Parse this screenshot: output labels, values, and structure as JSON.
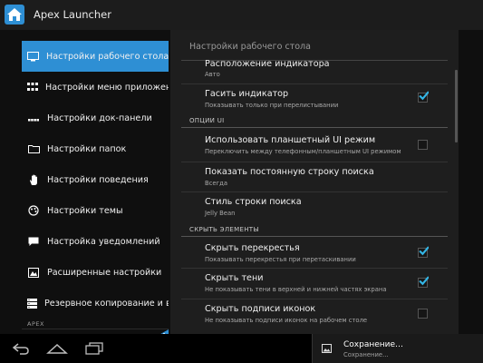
{
  "app": {
    "title": "Apex Launcher"
  },
  "sidebar": {
    "items": [
      {
        "label": "Настройки рабочего стола",
        "icon": "monitor-icon",
        "active": true
      },
      {
        "label": "Настройки меню приложений",
        "icon": "app-grid-icon",
        "active": false
      },
      {
        "label": "Настройки док-панели",
        "icon": "dock-icon",
        "active": false
      },
      {
        "label": "Настройки папок",
        "icon": "folder-icon",
        "active": false
      },
      {
        "label": "Настройки поведения",
        "icon": "hand-icon",
        "active": false
      },
      {
        "label": "Настройки темы",
        "icon": "palette-icon",
        "active": false
      },
      {
        "label": "Настройка уведомлений",
        "icon": "speech-bubble-icon",
        "active": false
      },
      {
        "label": "Расширенные настройки",
        "icon": "advanced-settings-icon",
        "active": false
      },
      {
        "label": "Резервное копирование и восс",
        "icon": "backup-icon",
        "active": false
      }
    ],
    "section_header": "APEX"
  },
  "panel": {
    "title": "Настройки рабочего стола",
    "prefs": [
      {
        "title": "Расположение индикатора",
        "summary": "Авто",
        "checkbox": null
      },
      {
        "title": "Гасить индикатор",
        "summary": "Показывать только при перелистывании",
        "checkbox": true
      },
      {
        "category": "ОПЦИИ UI"
      },
      {
        "title": "Использовать планшетный UI режим",
        "summary": "Переключить между телефонным/планшетным UI режимом",
        "checkbox": false
      },
      {
        "title": "Показать постоянную строку поиска",
        "summary": "Всегда",
        "checkbox": null
      },
      {
        "title": "Стиль строки поиска",
        "summary": "Jelly Bean",
        "checkbox": null
      },
      {
        "category": "СКРЫТЬ ЭЛЕМЕНТЫ"
      },
      {
        "title": "Скрыть перекрестья",
        "summary": "Показывать перекрестья при перетаскивании",
        "checkbox": true
      },
      {
        "title": "Скрыть тени",
        "summary": "Не показывать тени в верхней и нижней частях экрана",
        "checkbox": true
      },
      {
        "title": "Скрыть подписи иконок",
        "summary": "Не показывать подписи иконок на рабочем столе",
        "checkbox": false
      }
    ]
  },
  "notification": {
    "title": "Сохранение…",
    "subtitle": "Сохранение..."
  },
  "colors": {
    "accent": "#2e8fd4",
    "checkmark": "#33b5e5",
    "background": "#0f0f0f",
    "panel": "#1e1e1e"
  }
}
